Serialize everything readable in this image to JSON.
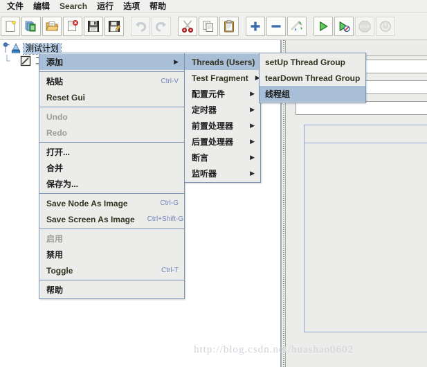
{
  "menubar": {
    "items": [
      {
        "label": "文件",
        "latin": false
      },
      {
        "label": "编辑",
        "latin": false
      },
      {
        "label": "Search",
        "latin": true
      },
      {
        "label": "运行",
        "latin": false
      },
      {
        "label": "选项",
        "latin": false
      },
      {
        "label": "帮助",
        "latin": false
      }
    ]
  },
  "toolbar": {
    "groups": [
      {
        "buttons": [
          {
            "icon": "new-document-icon",
            "disabled": false
          },
          {
            "icon": "templates-icon",
            "disabled": false
          },
          {
            "icon": "open-folder-icon",
            "disabled": false
          },
          {
            "icon": "close-document-icon",
            "disabled": false
          },
          {
            "icon": "save-icon",
            "disabled": false
          },
          {
            "icon": "save-as-icon",
            "disabled": false
          }
        ]
      },
      {
        "buttons": [
          {
            "icon": "undo-icon",
            "disabled": true
          },
          {
            "icon": "redo-icon",
            "disabled": true
          }
        ]
      },
      {
        "buttons": [
          {
            "icon": "cut-scissors-icon",
            "disabled": false
          },
          {
            "icon": "copy-icon",
            "disabled": false
          },
          {
            "icon": "paste-clipboard-icon",
            "disabled": false
          }
        ]
      },
      {
        "buttons": [
          {
            "icon": "expand-plus-icon",
            "disabled": false
          },
          {
            "icon": "collapse-minus-icon",
            "disabled": false
          },
          {
            "icon": "toggle-enable-icon",
            "disabled": false
          }
        ]
      },
      {
        "buttons": [
          {
            "icon": "start-play-icon",
            "disabled": false
          },
          {
            "icon": "start-no-timers-icon",
            "disabled": false
          },
          {
            "icon": "stop-icon",
            "disabled": true
          },
          {
            "icon": "shutdown-icon",
            "disabled": true
          }
        ]
      }
    ]
  },
  "tree": {
    "nodes": [
      {
        "label": "测试计划",
        "icon": "test-plan-icon",
        "selected": true
      },
      {
        "label": "工作台",
        "icon": "workbench-icon",
        "selected": false
      }
    ]
  },
  "context_menu": {
    "items": [
      {
        "label": "添加",
        "accel": "",
        "arrow": true,
        "highlighted": true,
        "disabled": false,
        "latin": false
      },
      {
        "type": "separator"
      },
      {
        "label": "粘贴",
        "accel": "Ctrl-V",
        "arrow": false,
        "highlighted": false,
        "disabled": false,
        "latin": false
      },
      {
        "label": "Reset Gui",
        "accel": "",
        "arrow": false,
        "highlighted": false,
        "disabled": false,
        "latin": true
      },
      {
        "type": "separator"
      },
      {
        "label": "Undo",
        "accel": "",
        "arrow": false,
        "highlighted": false,
        "disabled": true,
        "latin": true
      },
      {
        "label": "Redo",
        "accel": "",
        "arrow": false,
        "highlighted": false,
        "disabled": true,
        "latin": true
      },
      {
        "type": "separator"
      },
      {
        "label": "打开...",
        "accel": "",
        "arrow": false,
        "highlighted": false,
        "disabled": false,
        "latin": false
      },
      {
        "label": "合并",
        "accel": "",
        "arrow": false,
        "highlighted": false,
        "disabled": false,
        "latin": false
      },
      {
        "label": "保存为...",
        "accel": "",
        "arrow": false,
        "highlighted": false,
        "disabled": false,
        "latin": false
      },
      {
        "type": "separator"
      },
      {
        "label": "Save Node As Image",
        "accel": "Ctrl-G",
        "arrow": false,
        "highlighted": false,
        "disabled": false,
        "latin": true
      },
      {
        "label": "Save Screen As Image",
        "accel": "Ctrl+Shift-G",
        "arrow": false,
        "highlighted": false,
        "disabled": false,
        "latin": true
      },
      {
        "type": "separator"
      },
      {
        "label": "启用",
        "accel": "",
        "arrow": false,
        "highlighted": false,
        "disabled": true,
        "latin": false
      },
      {
        "label": "禁用",
        "accel": "",
        "arrow": false,
        "highlighted": false,
        "disabled": false,
        "latin": false
      },
      {
        "label": "Toggle",
        "accel": "Ctrl-T",
        "arrow": false,
        "highlighted": false,
        "disabled": false,
        "latin": true
      },
      {
        "type": "separator"
      },
      {
        "label": "帮助",
        "accel": "",
        "arrow": false,
        "highlighted": false,
        "disabled": false,
        "latin": false
      }
    ]
  },
  "add_submenu": {
    "items": [
      {
        "label": "Threads (Users)",
        "arrow": true,
        "highlighted": true,
        "latin": true
      },
      {
        "label": "Test Fragment",
        "arrow": true,
        "highlighted": false,
        "latin": true
      },
      {
        "label": "配置元件",
        "arrow": true,
        "highlighted": false,
        "latin": false
      },
      {
        "label": "定时器",
        "arrow": true,
        "highlighted": false,
        "latin": false
      },
      {
        "label": "前置处理器",
        "arrow": true,
        "highlighted": false,
        "latin": false
      },
      {
        "label": "后置处理器",
        "arrow": true,
        "highlighted": false,
        "latin": false
      },
      {
        "label": "断言",
        "arrow": true,
        "highlighted": false,
        "latin": false
      },
      {
        "label": "监听器",
        "arrow": true,
        "highlighted": false,
        "latin": false
      }
    ]
  },
  "threads_submenu": {
    "items": [
      {
        "label": "setUp Thread Group",
        "highlighted": false,
        "latin": true
      },
      {
        "label": "tearDown Thread Group",
        "highlighted": false,
        "latin": true
      },
      {
        "label": "线程组",
        "highlighted": true,
        "latin": false
      }
    ]
  },
  "watermark": {
    "text": "http://blog.csdn.net/huashao0602"
  }
}
